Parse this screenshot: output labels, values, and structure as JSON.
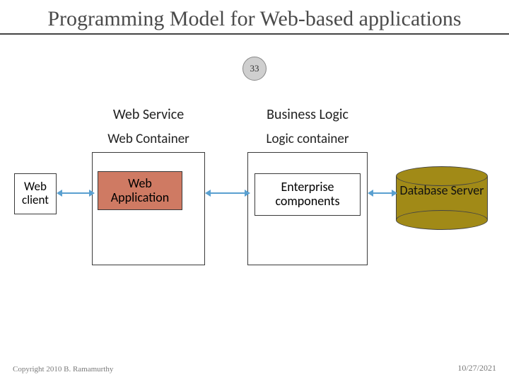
{
  "title": "Programming Model for Web-based applications",
  "page_number": "33",
  "columns": {
    "web_service": "Web Service",
    "business_logic": "Business Logic",
    "web_container": "Web Container",
    "logic_container": "Logic container"
  },
  "nodes": {
    "web_client": "Web client",
    "web_application": "Web Application",
    "enterprise_components": "Enterprise components",
    "database_server": "Database Server"
  },
  "footer": {
    "copyright": "Copyright 2010 B. Ramamurthy",
    "date": "10/27/2021"
  },
  "colors": {
    "web_app_fill": "#cf7a63",
    "db_fill": "#a18a17",
    "arrow": "#5aa0d0"
  }
}
